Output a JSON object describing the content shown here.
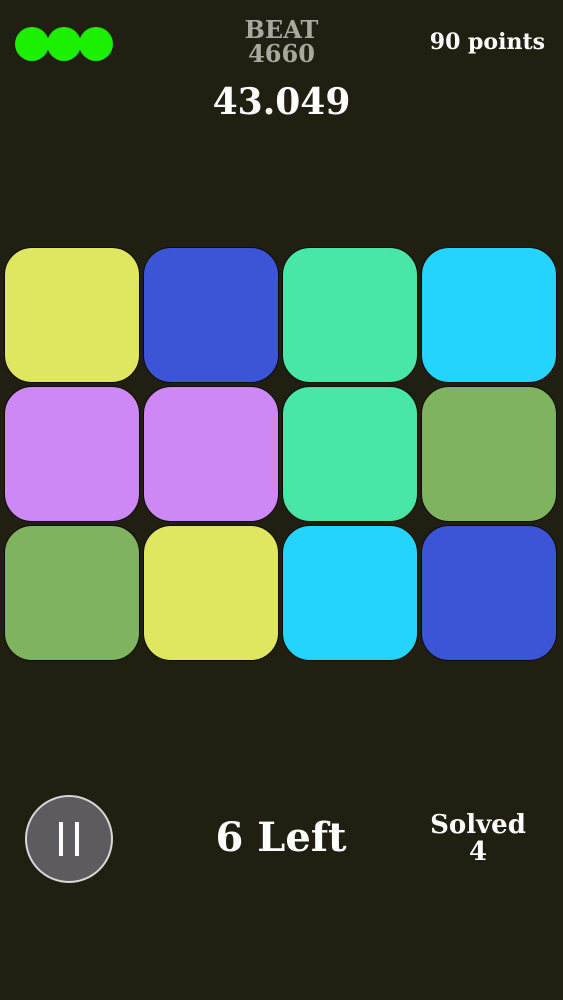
{
  "colors": {
    "background": "#211f11",
    "life": "#1bf000",
    "yellow": "#dfe760",
    "blue": "#3b55d6",
    "green": "#49e7a6",
    "cyan": "#25d4fd",
    "purple": "#cd88f5",
    "olive": "#7fb35f"
  },
  "header": {
    "lives": 3,
    "beat_label": "BEAT",
    "beat_score": "4660",
    "points": "90 points",
    "timer": "43.049"
  },
  "board": {
    "rows": 3,
    "columns": 4,
    "tiles": [
      "yellow",
      "blue",
      "green",
      "cyan",
      "purple",
      "purple",
      "green",
      "olive",
      "olive",
      "yellow",
      "cyan",
      "blue"
    ]
  },
  "footer": {
    "pause_icon": "pause-icon",
    "left": "6 Left",
    "solved_label": "Solved",
    "solved_count": "4"
  }
}
